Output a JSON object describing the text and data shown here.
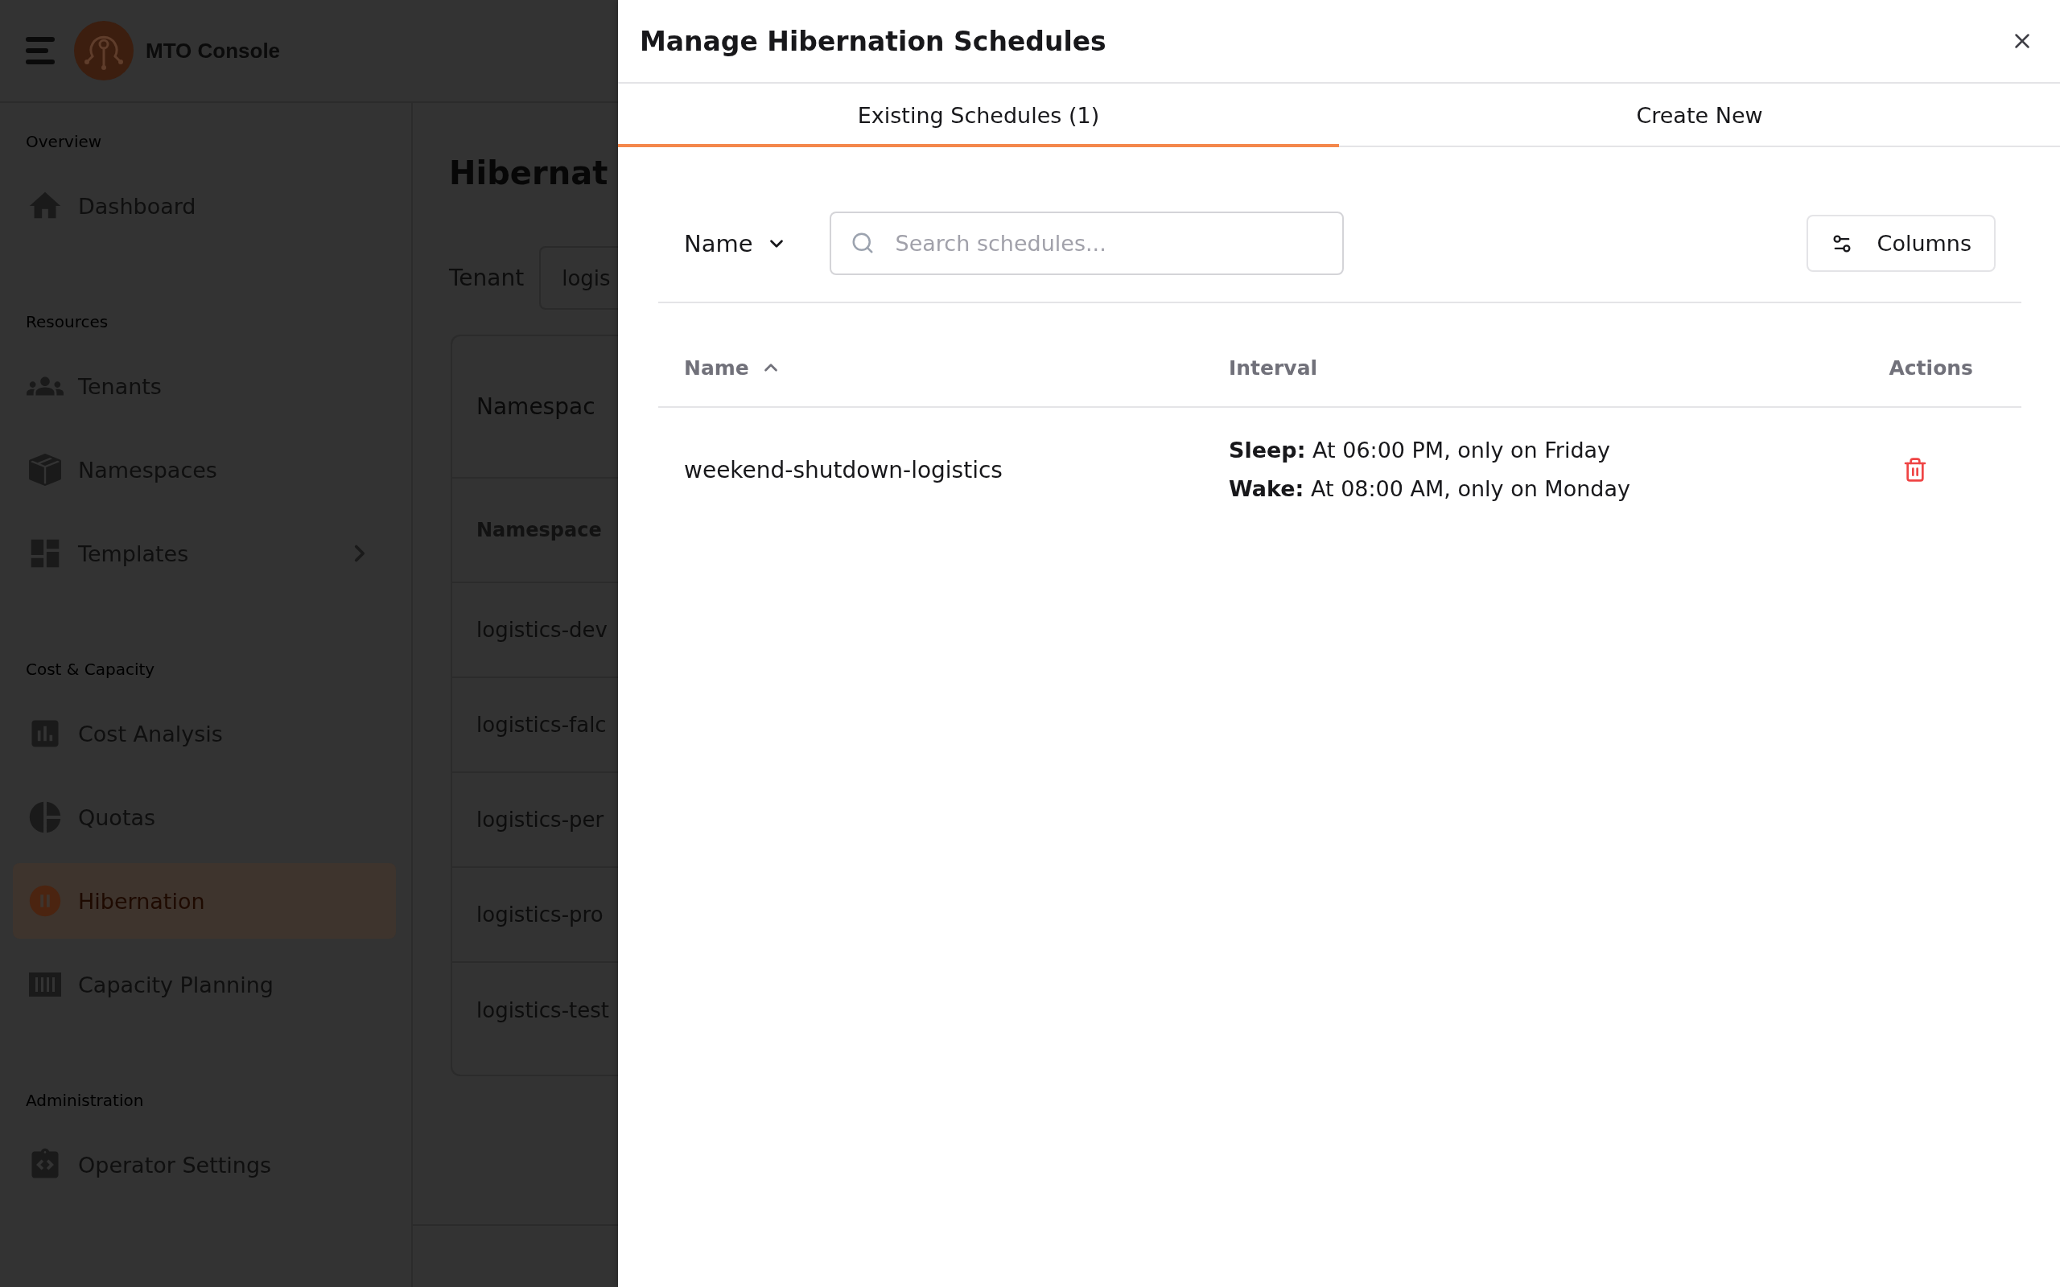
{
  "app": {
    "title": "MTO Console"
  },
  "sidebar": {
    "sections": [
      {
        "heading": "Overview",
        "items": [
          {
            "label": "Dashboard",
            "kind": "link",
            "selected": false
          }
        ]
      },
      {
        "heading": "Resources",
        "items": [
          {
            "label": "Tenants",
            "kind": "link",
            "selected": false
          },
          {
            "label": "Namespaces",
            "kind": "link",
            "selected": false
          },
          {
            "label": "Templates",
            "kind": "group",
            "selected": false
          }
        ]
      },
      {
        "heading": "Cost & Capacity",
        "items": [
          {
            "label": "Cost Analysis",
            "kind": "link",
            "selected": false
          },
          {
            "label": "Quotas",
            "kind": "link",
            "selected": false
          },
          {
            "label": "Hibernation",
            "kind": "link",
            "selected": true
          },
          {
            "label": "Capacity Planning",
            "kind": "link",
            "selected": false
          }
        ]
      },
      {
        "heading": "Administration",
        "items": [
          {
            "label": "Operator Settings",
            "kind": "link",
            "selected": false
          }
        ]
      }
    ]
  },
  "page": {
    "title": "Hibernat",
    "tenant": {
      "label": "Tenant",
      "value": "logis"
    },
    "card": {
      "title": "Namespac",
      "column": "Namespace",
      "rows": [
        "logistics-dev",
        "logistics-falc",
        "logistics-per",
        "logistics-pro",
        "logistics-test"
      ]
    }
  },
  "dialog": {
    "title": "Manage Hibernation Schedules",
    "tabs": [
      {
        "label": "Existing Schedules (1)",
        "selected": true
      },
      {
        "label": "Create New",
        "selected": false
      }
    ],
    "filter_select": {
      "value": "Name"
    },
    "search": {
      "placeholder": "Search schedules..."
    },
    "columns_button": {
      "label": "Columns"
    },
    "table": {
      "columns": [
        {
          "label": "Name",
          "sorted": true
        },
        {
          "label": "Interval",
          "sorted": false
        },
        {
          "label": "Actions",
          "sorted": false
        }
      ],
      "rows": [
        {
          "name": "weekend-shutdown-logistics",
          "interval": [
            "**Sleep:** At 06:00 PM, only on Friday",
            "**Wake:** At 08:00 AM, only on Monday"
          ]
        }
      ]
    }
  }
}
